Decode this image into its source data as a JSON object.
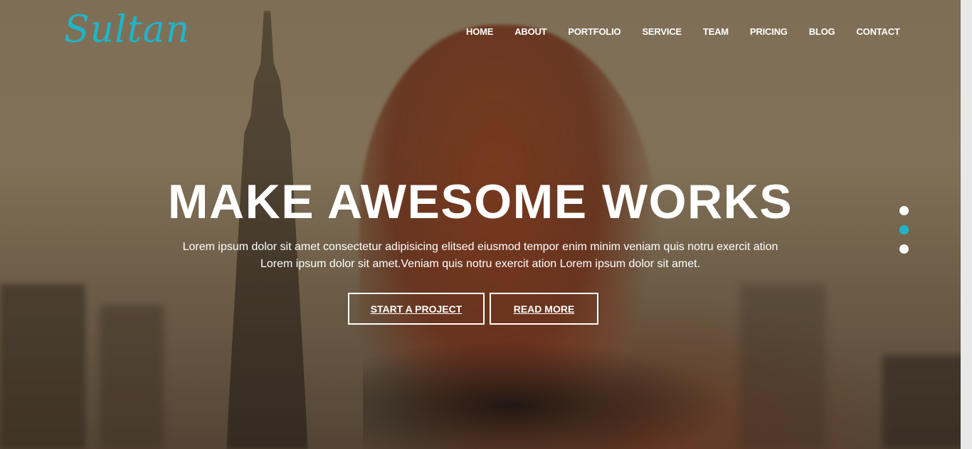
{
  "brand": {
    "logo_text": "Sultan",
    "accent_color": "#1fb5c9"
  },
  "nav": {
    "items": [
      "HOME",
      "ABOUT",
      "PORTFOLIO",
      "SERVICE",
      "TEAM",
      "PRICING",
      "BLOG",
      "CONTACT"
    ]
  },
  "hero": {
    "headline": "MAKE AWESOME WORKS",
    "subtext_line1": "Lorem ipsum dolor sit amet consectetur adipisicing elitsed eiusmod tempor enim minim veniam quis notru exercit ation",
    "subtext_line2": "Lorem ipsum dolor sit amet.Veniam quis notru exercit ation Lorem ipsum dolor sit amet.",
    "primary_button": "START A PROJECT",
    "secondary_button": "READ MORE"
  },
  "slider": {
    "dot_count": 3,
    "active_index": 1
  }
}
